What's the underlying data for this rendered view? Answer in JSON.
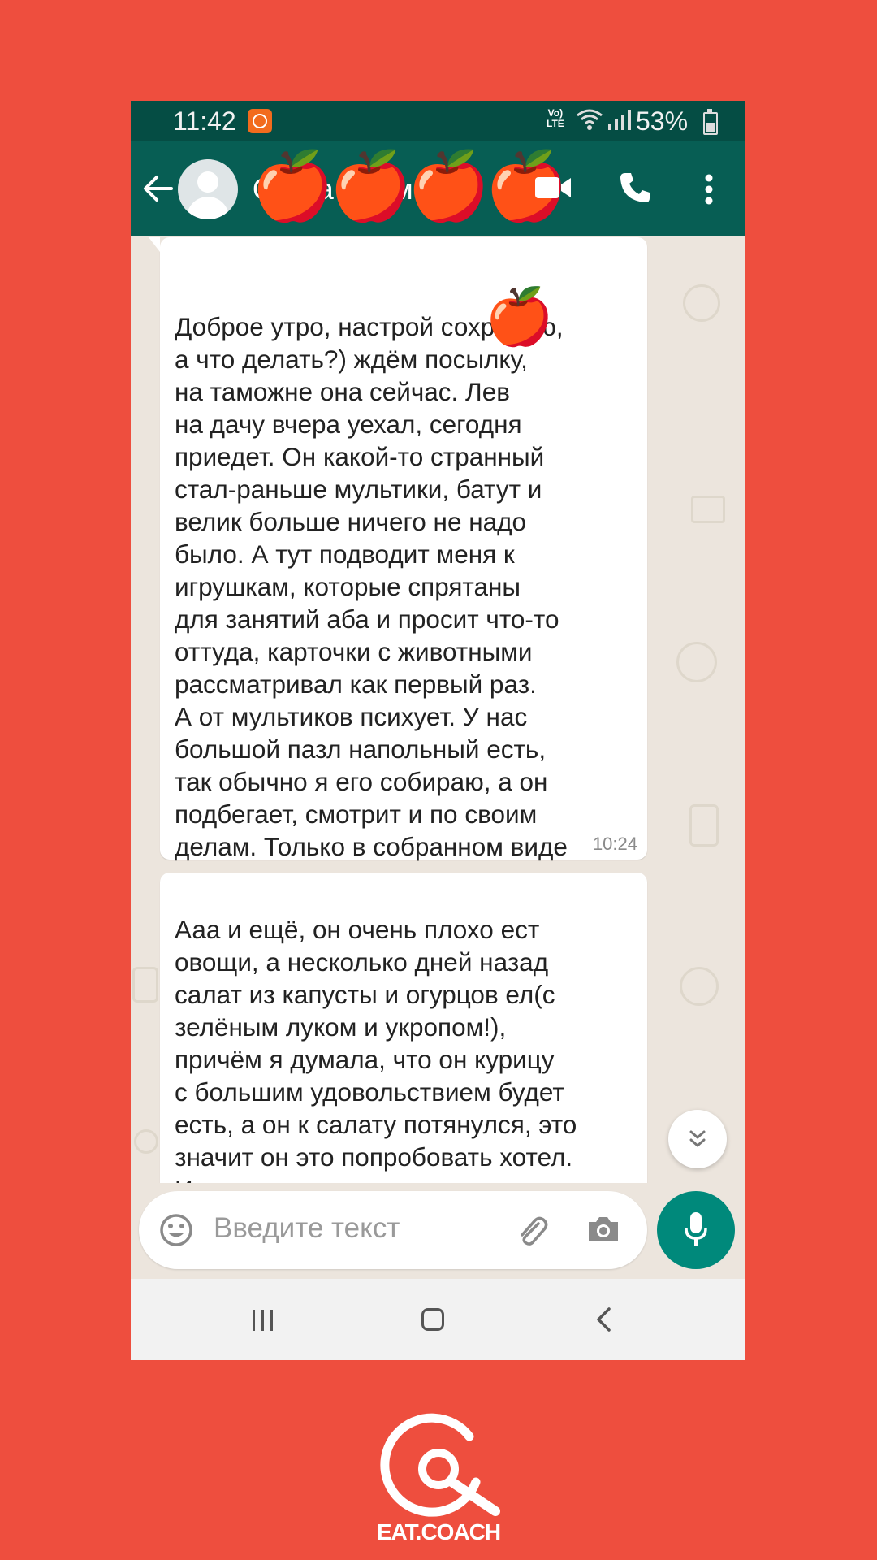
{
  "status_bar": {
    "time": "11:42",
    "network": "Vo)) LTE",
    "battery": "53%",
    "battery_level": 0.53
  },
  "header": {
    "contact_name": "Ольга Наумова",
    "apples": "🍎🍎🍎🍎"
  },
  "messages": [
    {
      "text": "Доброе утро, настрой сохраняю,\nа что делать?) ждём посылку,\nна таможне она сейчас. Лев\nна дачу вчера уехал, сегодня\nприедет. Он какой-то странный\nстал-раньше мультики, батут и\nвелик больше ничего не надо\nбыло. А тут подводит меня к\nигрушкам, которые спрятаны\nдля занятий аба и просит что-то\nоттуда, карточки с животными\nрассматривал как первый раз.\nА от мультиков психует. У нас\nбольшой пазл напольный есть,\nтак обычно я его собираю, а он\nподбегает, смотрит и по своим\nделам. Только в собранном виде\nизучает, а позавчера мне два или\nтри элемента дал в тему.",
      "time": "10:24",
      "apple": "🍎"
    },
    {
      "text": "Ааа и ещё, он очень плохо ест\nовощи, а несколько дней назад\nсалат из капусты и огурцов ел(с\nзелёным луком и укропом!),\nпричём я думала, что он курицу\nс большим удовольствием будет\nесть, а он к салату потянулся, это\nзначит он это попробовать хотел.\nИ ест как-то основательно два раза\nв день."
    }
  ],
  "input": {
    "placeholder": "Введите текст"
  },
  "icons": [
    "back-arrow-icon",
    "video-call-icon",
    "phone-icon",
    "more-vert-icon",
    "emoji-icon",
    "attach-icon",
    "camera-icon",
    "mic-icon",
    "scroll-down-icon",
    "nav-recent-icon",
    "nav-home-icon",
    "nav-back-icon"
  ],
  "colors": {
    "background": "#EE4E3E",
    "header": "#075E54",
    "statusbar": "#054D44",
    "chat_bg": "#ECE5DD",
    "mic": "#00897B"
  },
  "brand": {
    "name": "EAT.COACH"
  }
}
